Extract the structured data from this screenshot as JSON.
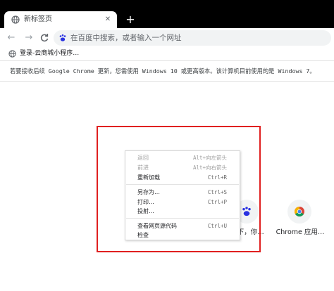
{
  "tab": {
    "title": "新标签页",
    "close_glyph": "✕",
    "favicon": "globe-icon"
  },
  "new_tab_glyph": "+",
  "toolbar": {
    "back_glyph": "←",
    "forward_glyph": "→",
    "reload_glyph": "C",
    "omnibox_placeholder": "在百度中搜索，或者输入一个网址",
    "omnibox_icon": "baidu-paw-icon"
  },
  "bookmarks": {
    "items": [
      {
        "label": "登录-云商城小程序…",
        "icon": "globe-icon"
      }
    ]
  },
  "infobar": {
    "text": "若要接收后续 Google Chrome 更新，您需使用 Windows 10 或更高版本。该计算机目前使用的是 Windows 7。"
  },
  "shortcuts": [
    {
      "label": "一下，你…",
      "icon": "baidu-paw-icon"
    },
    {
      "label": "Chrome 应用…",
      "icon": "chrome-logo-icon"
    }
  ],
  "context_menu": {
    "items": [
      {
        "label": "返回",
        "shortcut": "Alt+向左箭头",
        "enabled": false
      },
      {
        "label": "前进",
        "shortcut": "Alt+向右箭头",
        "enabled": false
      },
      {
        "label": "重新加载",
        "shortcut": "Ctrl+R",
        "enabled": true
      },
      {
        "label": "另存为…",
        "shortcut": "Ctrl+S",
        "enabled": true
      },
      {
        "label": "打印…",
        "shortcut": "Ctrl+P",
        "enabled": true
      },
      {
        "label": "投射…",
        "shortcut": "",
        "enabled": true
      },
      {
        "label": "查看网页源代码",
        "shortcut": "Ctrl+U",
        "enabled": true
      },
      {
        "label": "检查",
        "shortcut": "",
        "enabled": true
      }
    ]
  },
  "colors": {
    "annotation_box": "#e02020",
    "tabstrip": "#000000",
    "omnibox_bg": "#f1f3f4"
  }
}
